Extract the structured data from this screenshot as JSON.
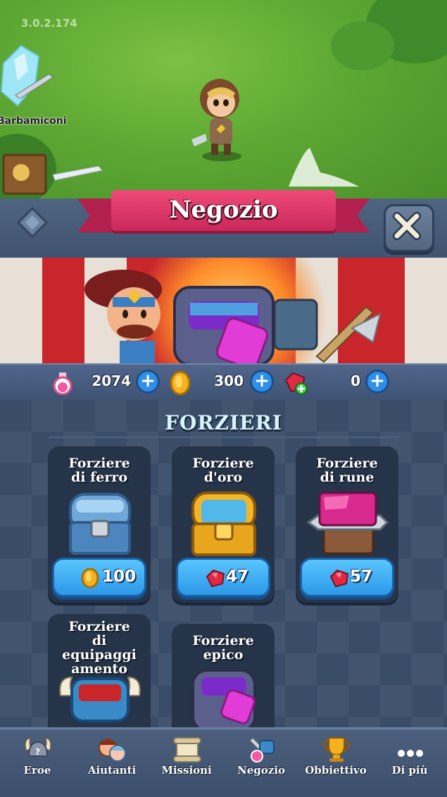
{
  "game": {
    "version": "3.0.2.174",
    "player_name": "Barbamiconi"
  },
  "shop": {
    "title": "Negozio",
    "close_icon": "close-icon"
  },
  "currency": {
    "potions": "2074",
    "gold": "300",
    "gems": "0"
  },
  "section": {
    "title": "FORZIERI"
  },
  "chests": [
    {
      "name_line1": "Forziere",
      "name_line2": "di ferro",
      "price": "100",
      "currency": "gold-coin-icon"
    },
    {
      "name_line1": "Forziere",
      "name_line2": "d'oro",
      "price": "47",
      "currency": "red-gem-icon"
    },
    {
      "name_line1": "Forziere",
      "name_line2": "di rune",
      "price": "57",
      "currency": "red-gem-icon"
    },
    {
      "name_line1": "Forziere",
      "name_line2": "di",
      "name_line3": "equipaggi",
      "name_line4": "amento"
    },
    {
      "name_line1": "Forziere",
      "name_line2": "epico"
    }
  ],
  "nav": [
    {
      "label": "Eroe",
      "icon": "viking-helmet-icon"
    },
    {
      "label": "Aiutanti",
      "icon": "helpers-icon"
    },
    {
      "label": "Missioni",
      "icon": "scroll-icon"
    },
    {
      "label": "Negozio",
      "icon": "shop-icon"
    },
    {
      "label": "Obbiettivo",
      "icon": "trophy-icon"
    },
    {
      "label": "Di più",
      "icon": "more-dots-icon"
    }
  ],
  "colors": {
    "ribbon": "#e53a6c",
    "buy_button": "#3aa9f0",
    "panel": "#34465f"
  }
}
